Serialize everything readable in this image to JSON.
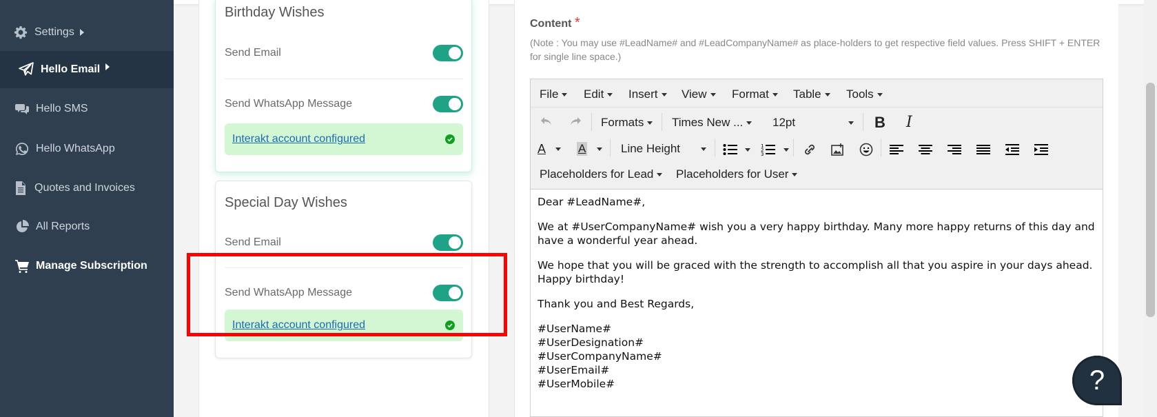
{
  "sidebar": {
    "items": [
      {
        "label": "Settings",
        "icon": "gear-icon"
      },
      {
        "label": "Hello Email",
        "icon": "paper-plane-icon"
      },
      {
        "label": "Hello SMS",
        "icon": "chat-icon"
      },
      {
        "label": "Hello WhatsApp",
        "icon": "whatsapp-icon"
      },
      {
        "label": "Quotes and Invoices",
        "icon": "document-icon"
      },
      {
        "label": "All Reports",
        "icon": "pie-chart-icon"
      },
      {
        "label": "Manage Subscription",
        "icon": "cart-icon"
      }
    ]
  },
  "birthday": {
    "title": "Birthday Wishes",
    "send_email": "Send Email",
    "send_whatsapp": "Send WhatsApp Message",
    "interakt": "Interakt account configured",
    "email_on": true,
    "whatsapp_on": true
  },
  "special": {
    "title": "Special Day Wishes",
    "send_email": "Send Email",
    "send_whatsapp": "Send WhatsApp Message",
    "interakt": "Interakt account configured",
    "email_on": true,
    "whatsapp_on": true
  },
  "content": {
    "label": "Content",
    "required": "*",
    "note": "(Note : You may use #LeadName# and #LeadCompanyName# as place-holders to get respective field values. Press SHIFT + ENTER for single line space.)"
  },
  "editor": {
    "menus": [
      "File",
      "Edit",
      "Insert",
      "View",
      "Format",
      "Table",
      "Tools"
    ],
    "formats": "Formats",
    "font": "Times New ...",
    "size": "12pt",
    "line_height": "Line Height",
    "placeholders_lead": "Placeholders for Lead",
    "placeholders_user": "Placeholders for User",
    "body": {
      "greeting": "Dear #LeadName#,",
      "p1": "We at #UserCompanyName# wish you a very happy birthday. Many more happy returns of this day and have a wonderful year ahead.",
      "p2": "We hope that you will be graced with the strength to accomplish all that you aspire in your days ahead. Happy birthday!",
      "p3": "Thank you and Best Regards,",
      "sig": [
        "#UserName#",
        "#UserDesignation#",
        "#UserCompanyName#",
        "#UserEmail#",
        "#UserMobile#"
      ]
    }
  },
  "help": {
    "label": "?"
  },
  "colors": {
    "sidebar": "#2f3f4f",
    "toggle": "#1fa386",
    "success_bg": "#d4f7d3",
    "highlight": "#ff0000"
  }
}
